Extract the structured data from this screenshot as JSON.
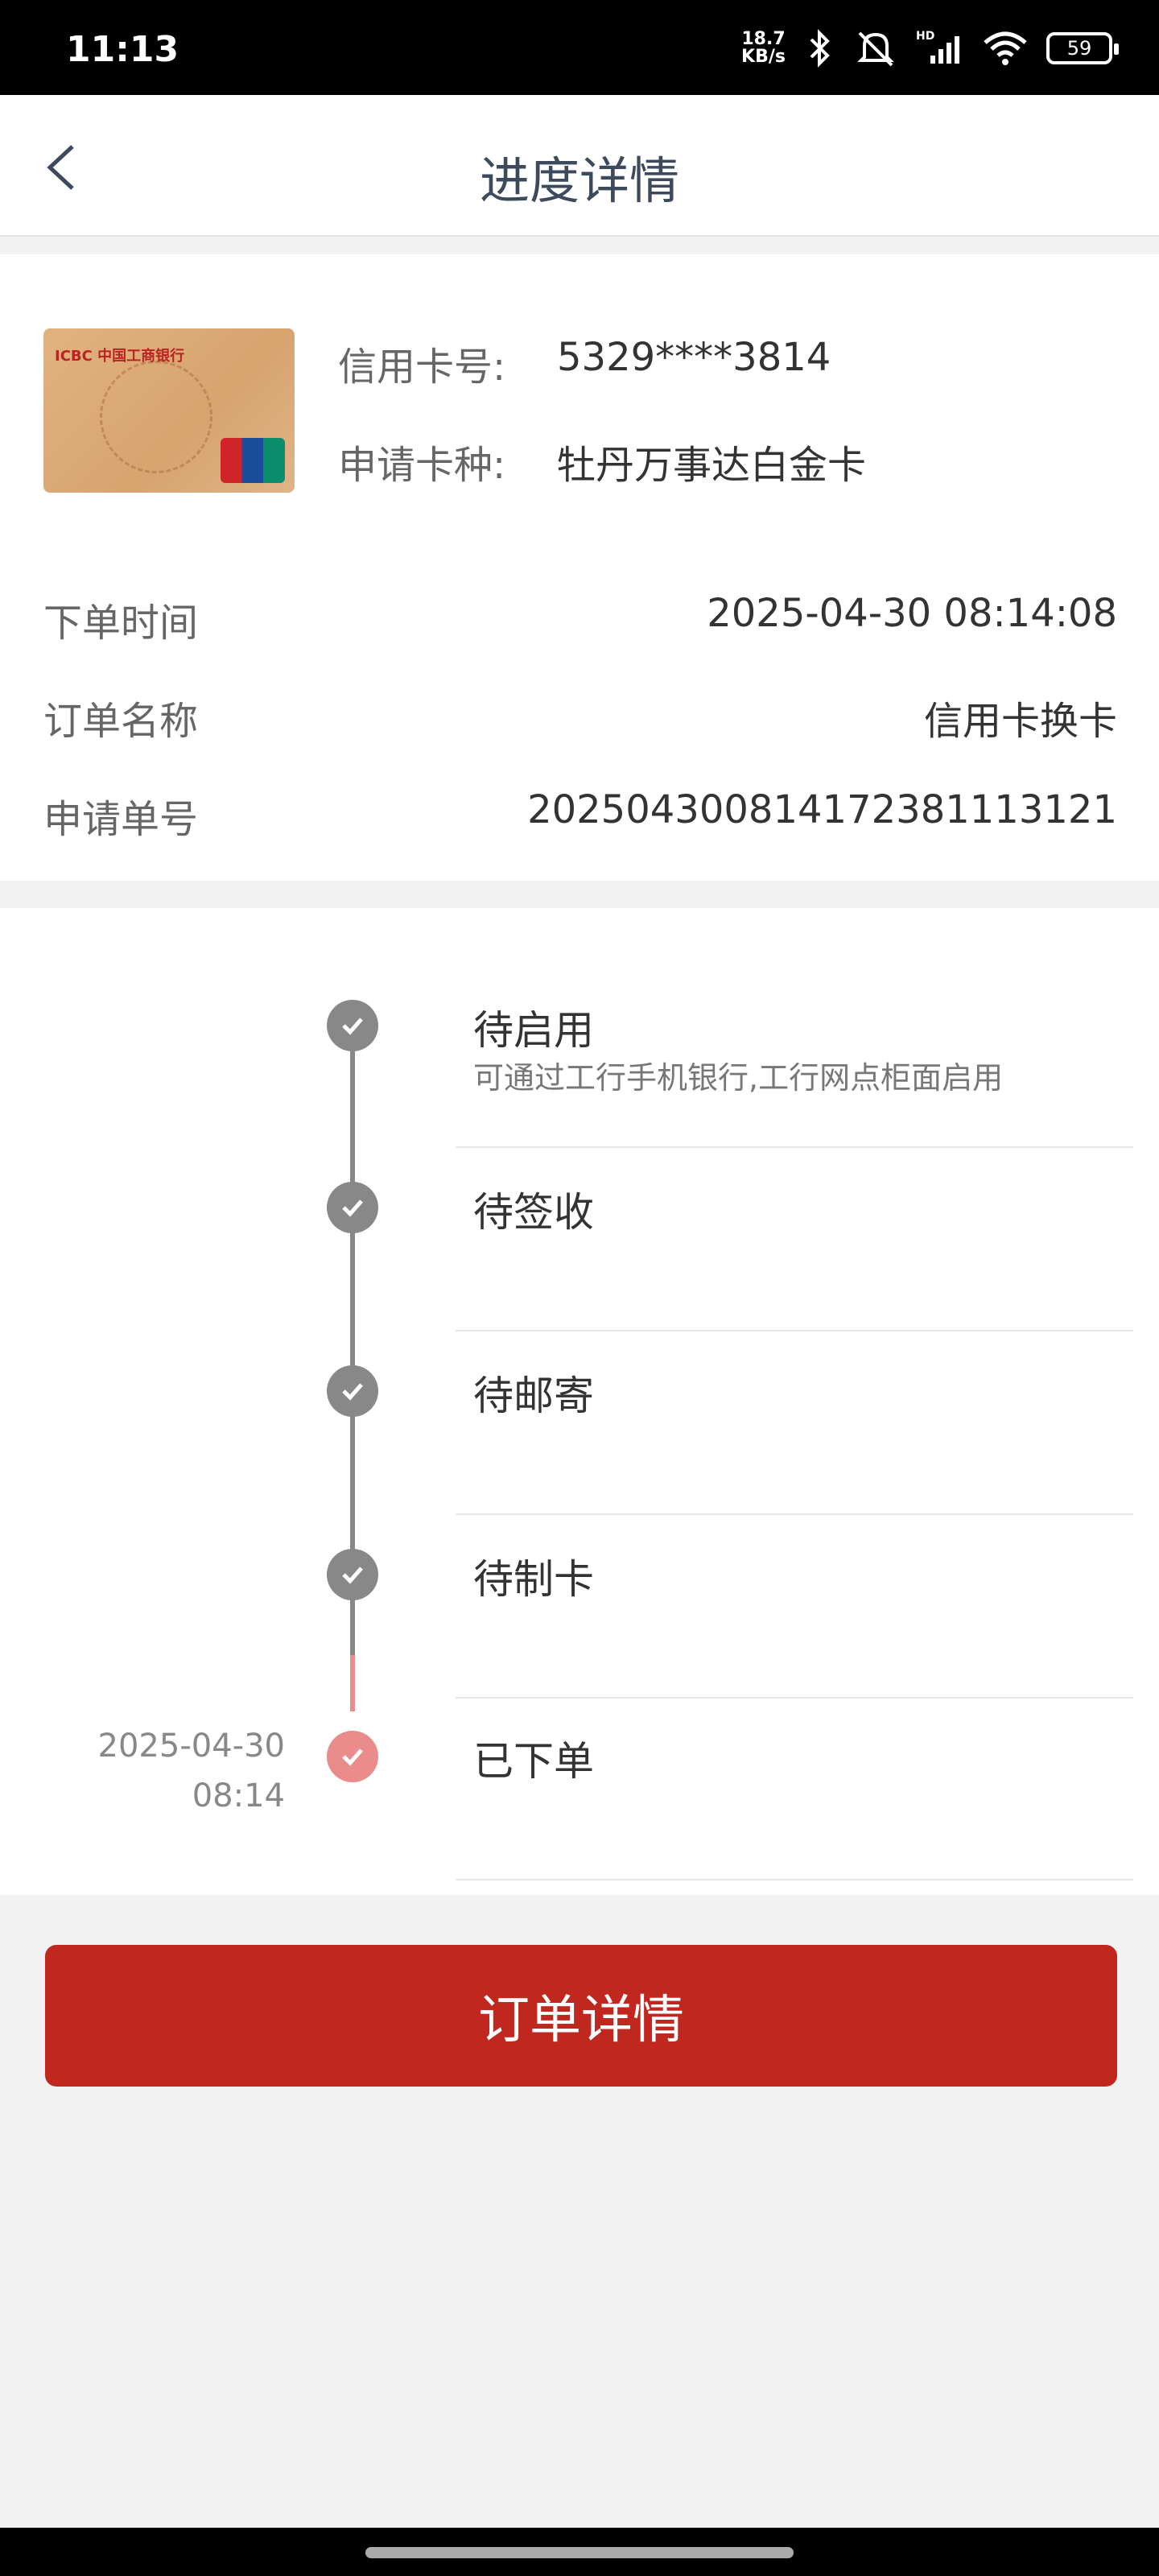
{
  "status_bar": {
    "time": "11:13",
    "net_speed_value": "18.7",
    "net_speed_unit": "KB/s",
    "battery": "59"
  },
  "header": {
    "title": "进度详情"
  },
  "card": {
    "bank_logo_text": "ICBC 中国工商银行",
    "number_label": "信用卡号:",
    "number_value": "5329****3814",
    "type_label": "申请卡种:",
    "type_value": "牡丹万事达白金卡"
  },
  "order_info": [
    {
      "label": "下单时间",
      "value": "2025-04-30 08:14:08"
    },
    {
      "label": "订单名称",
      "value": "信用卡换卡"
    },
    {
      "label": "申请单号",
      "value": "2025043008141723811131​21"
    }
  ],
  "timeline": [
    {
      "title": "待启用",
      "desc": "可通过工行手机银行,工行网点柜面启用",
      "status": "done"
    },
    {
      "title": "待签收",
      "desc": "",
      "status": "done"
    },
    {
      "title": "待邮寄",
      "desc": "",
      "status": "done"
    },
    {
      "title": "待制卡",
      "desc": "",
      "status": "done"
    },
    {
      "title": "已下单",
      "desc": "",
      "status": "current",
      "date": "2025-04-30",
      "time": "08:14"
    }
  ],
  "actions": {
    "order_detail_button": "订单详情"
  },
  "colors": {
    "primary_red": "#c0281f",
    "timeline_done": "#888888",
    "timeline_current": "#ea8c8c"
  }
}
